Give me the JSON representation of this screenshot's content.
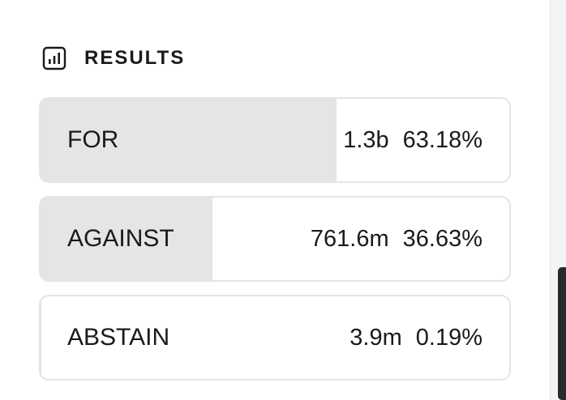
{
  "results": {
    "title": "RESULTS",
    "icon": "bar-chart-icon",
    "options": [
      {
        "label": "FOR",
        "amount": "1.3b",
        "percent": "63.18%",
        "share": 0.6318
      },
      {
        "label": "AGAINST",
        "amount": "761.6m",
        "percent": "36.63%",
        "share": 0.3663
      },
      {
        "label": "ABSTAIN",
        "amount": "3.9m",
        "percent": "0.19%",
        "share": 0.0019
      }
    ]
  },
  "colors": {
    "fill": "#e5e5e5",
    "border": "#e4e4e4",
    "text": "#1a1a1a"
  }
}
